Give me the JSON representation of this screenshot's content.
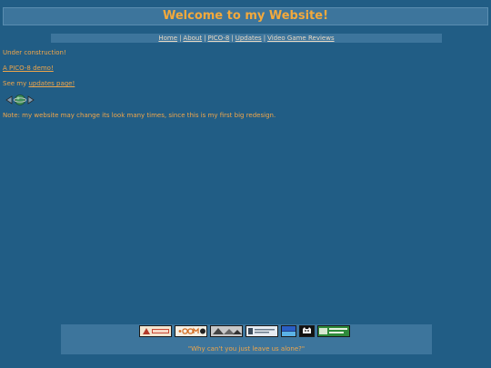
{
  "header": {
    "title": "Welcome to my Website!"
  },
  "nav": {
    "items": [
      "Home",
      "About",
      "PICO-8",
      "Updates",
      "Video Game Reviews"
    ],
    "separator": "|"
  },
  "main": {
    "status_text": "Under construction!",
    "demo_link": "A PICO-8 demo!",
    "updates_prefix": "See my ",
    "updates_link": "updates page!",
    "note": "Note: my website may change its look many times, since this is my first big redesign."
  },
  "footer": {
    "quote": "\"Why can't you just leave us alone?\"",
    "badges": [
      "webring-badge",
      "dotcom-badge",
      "site-badge-3",
      "site-badge-4",
      "site-badge-5",
      "cat-badge",
      "silicon-valley-badge"
    ]
  },
  "colors": {
    "background": "#215d85",
    "panel": "#3d759c",
    "text": "#f0a64a",
    "nav_text": "#e9d9c4"
  }
}
